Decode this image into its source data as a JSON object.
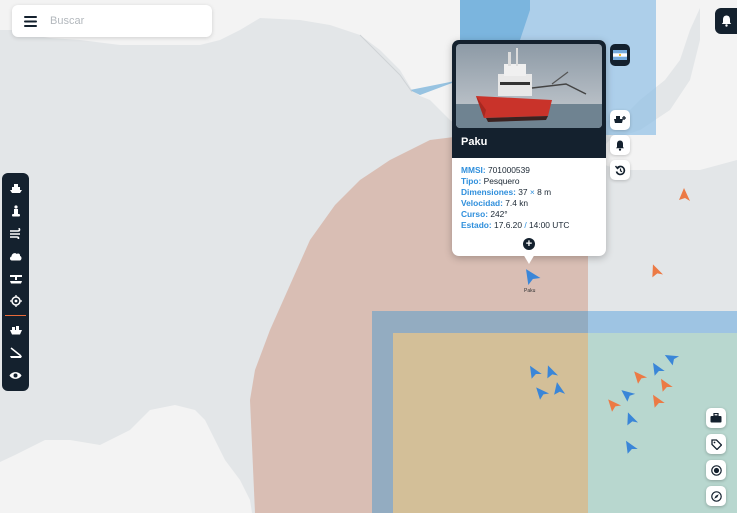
{
  "search": {
    "placeholder": "Buscar"
  },
  "vessel": {
    "name": "Paku",
    "mmsi_label": "MMSI:",
    "mmsi": "701000539",
    "tipo_label": "Tipo:",
    "tipo": "Pesquero",
    "dim_label": "Dimensiones:",
    "dim_a": "37",
    "dim_sep": "×",
    "dim_b": "8 m",
    "vel_label": "Velocidad:",
    "vel": "7.4 kn",
    "curso_label": "Curso:",
    "curso": "242°",
    "estado_label": "Estado:",
    "estado_date": "17.6.20",
    "estado_sep": "/",
    "estado_time": "14:00 UTC",
    "flag_country": "Argentina",
    "map_label": "Paku"
  },
  "left_toolbar": [
    "vessels-icon",
    "buoy-icon",
    "wind-icon",
    "weather-icon",
    "ports-icon",
    "target-icon",
    "fleet-icon",
    "fishing-icon",
    "eye-icon"
  ],
  "right_toolbar": [
    "briefcase-icon",
    "tag-icon",
    "record-icon",
    "compass-icon"
  ],
  "colors": {
    "dark": "#14212e",
    "accent": "#2f8fdc",
    "orange": "#ec7a45",
    "zone": "#d7b9ae",
    "water": "#e3e6e8",
    "land": "#f3f3f3"
  }
}
